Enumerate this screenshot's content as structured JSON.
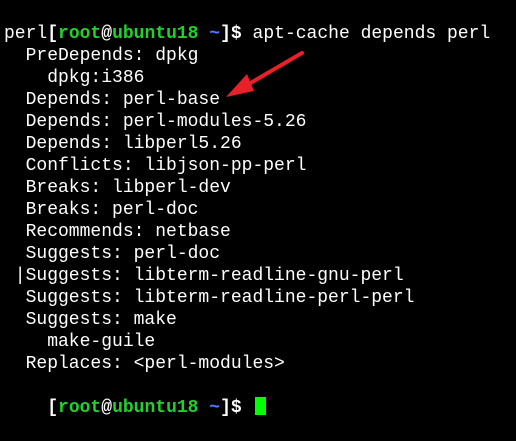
{
  "prompt": {
    "open": "[",
    "user": "root",
    "at": "@",
    "host": "ubuntu18",
    "path": "~",
    "close": "]",
    "symbol": "$"
  },
  "command": "apt-cache depends perl",
  "output": [
    "perl",
    "  PreDepends: dpkg",
    "    dpkg:i386",
    "  Depends: perl-base",
    "  Depends: perl-modules-5.26",
    "  Depends: libperl5.26",
    "  Conflicts: libjson-pp-perl",
    "  Breaks: libperl-dev",
    "  Breaks: perl-doc",
    "  Recommends: netbase",
    "  Suggests: perl-doc",
    " |Suggests: libterm-readline-gnu-perl",
    "  Suggests: libterm-readline-perl-perl",
    "  Suggests: make",
    "    make-guile",
    "  Replaces: <perl-modules>"
  ],
  "colors": {
    "background": "#000000",
    "text": "#ffffff",
    "prompt_user": "#22d22c",
    "prompt_path": "#4f7cff",
    "cursor": "#00ff00",
    "annotation_arrow": "#e8202a"
  },
  "annotation_icon": "red-arrow-icon"
}
